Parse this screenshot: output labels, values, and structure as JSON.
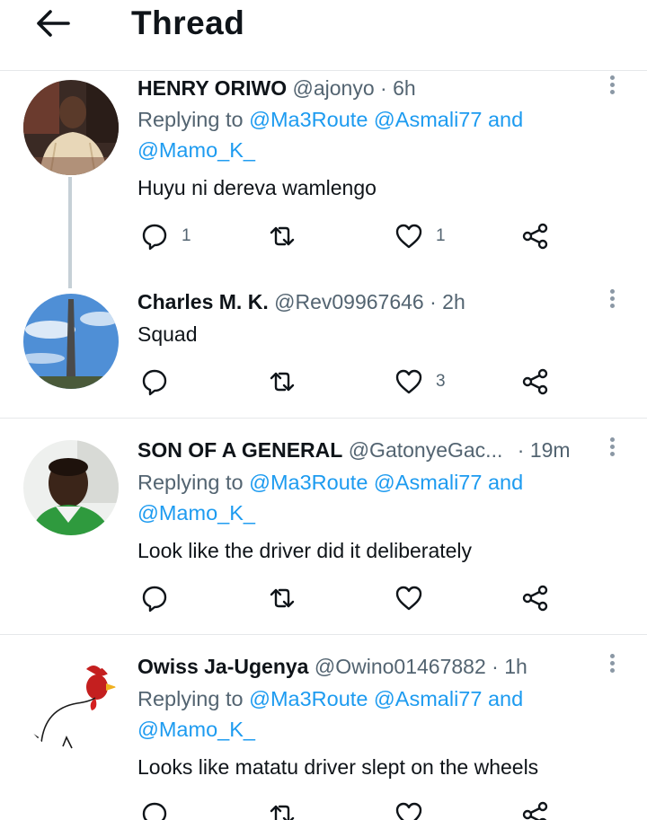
{
  "header": {
    "title": "Thread"
  },
  "tweets": [
    {
      "name": "HENRY ORIWO",
      "handle": "@ajonyo",
      "dot": "·",
      "time": "6h",
      "replying_prefix": "Replying to ",
      "mentions": [
        "@Ma3Route",
        "@Asmali77",
        "@Mamo_K_"
      ],
      "and_word": "and",
      "text": "Huyu ni dereva wamlengo",
      "replies": "1",
      "retweets": "",
      "likes": "1"
    },
    {
      "name": "Charles M. K.",
      "handle": "@Rev09967646",
      "dot": "·",
      "time": "2h",
      "text": "Squad",
      "replies": "",
      "retweets": "",
      "likes": "3"
    },
    {
      "name": "SON OF A GENERAL",
      "handle": "@GatonyeGac...",
      "dot": "·",
      "time": "19m",
      "replying_prefix": "Replying to ",
      "mentions": [
        "@Ma3Route",
        "@Asmali77",
        "@Mamo_K_"
      ],
      "and_word": "and",
      "text": "Look like the driver did it deliberately",
      "replies": "",
      "retweets": "",
      "likes": ""
    },
    {
      "name": "Owiss Ja-Ugenya",
      "handle": "@Owino01467882",
      "dot": "·",
      "time": "1h",
      "replying_prefix": "Replying to ",
      "mentions": [
        "@Ma3Route",
        "@Asmali77",
        "@Mamo_K_"
      ],
      "and_word": "and",
      "text": "Looks like matatu driver slept on the wheels",
      "replies": "",
      "retweets": "",
      "likes": ""
    }
  ],
  "icons": {
    "back": "arrow-left-icon",
    "reply": "speech-bubble-icon",
    "retweet": "retweet-icon",
    "like": "heart-icon",
    "share": "share-icon",
    "more": "vertical-ellipsis-icon"
  },
  "colors": {
    "mention": "#1d9bf0",
    "secondary_text": "#536471",
    "divider": "#e6e8ea",
    "thread_line": "#c6d0d6"
  }
}
